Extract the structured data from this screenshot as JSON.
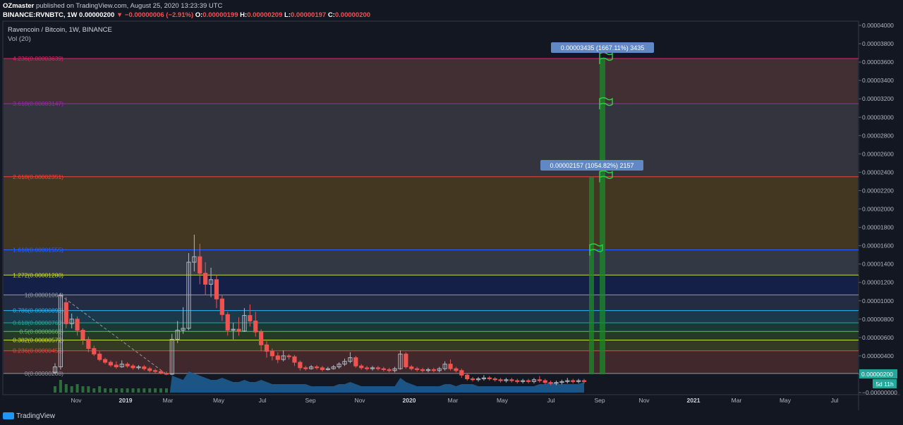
{
  "header": {
    "author": "OZmaster",
    "published_text": "published on TradingView.com, August 25, 2020 13:23:39 UTC",
    "symbol": "BINANCE:RVNBTC, 1W",
    "last_price": "0.00000200",
    "change": "▼ −0.00000006 (−2.91%)",
    "o_label": "O:",
    "o_value": "0.00000199",
    "h_label": "H:",
    "h_value": "0.00000209",
    "l_label": "L:",
    "l_value": "0.00000197",
    "c_label": "C:",
    "c_value": "0.00000200"
  },
  "chart_title": "Ravencoin / Bitcoin, 1W, BINANCE",
  "volume_title": "Vol (20)",
  "footer": {
    "brand": "TradingView"
  },
  "chart_data": {
    "type": "candlestick",
    "y_axis": {
      "min": 0.0,
      "max": 4e-05,
      "ticks": [
        "0.00004000",
        "0.00003800",
        "0.00003600",
        "0.00003400",
        "0.00003200",
        "0.00003000",
        "0.00002800",
        "0.00002600",
        "0.00002400",
        "0.00002200",
        "0.00002000",
        "0.00001800",
        "0.00001600",
        "0.00001400",
        "0.00001200",
        "0.00001000",
        "0.00000800",
        "0.00000600",
        "0.00000400",
        "0.00000200",
        "−0.00000000"
      ],
      "position": "right"
    },
    "x_axis": {
      "ticks": [
        "Nov",
        "2019",
        "Mar",
        "May",
        "Jul",
        "Sep",
        "Nov",
        "2020",
        "Mar",
        "May",
        "Jul",
        "Sep",
        "Nov",
        "2021",
        "Mar",
        "May",
        "Jul"
      ],
      "ticks_bold": [
        "2019",
        "2020",
        "2021"
      ]
    },
    "fib_levels": [
      {
        "label": "4.236(0.00003639)",
        "value": 3.639e-05,
        "color": "#e91e63"
      },
      {
        "label": "3.618(0.00003147)",
        "value": 3.147e-05,
        "color": "#9c27b0"
      },
      {
        "label": "2.618(0.00002351)",
        "value": 2.351e-05,
        "color": "#f44336"
      },
      {
        "label": "1.618(0.00001555)",
        "value": 1.555e-05,
        "color": "#2962ff"
      },
      {
        "label": "1.272(0.00001280)",
        "value": 1.28e-05,
        "color": "#cddc39"
      },
      {
        "label": "1(0.00001064)",
        "value": 1.064e-05,
        "color": "#9598a1"
      },
      {
        "label": "0.786(0.00000893)",
        "value": 8.93e-06,
        "color": "#29b6f6"
      },
      {
        "label": "0.618(0.00000760)",
        "value": 7.6e-06,
        "color": "#26a69a"
      },
      {
        "label": "0.5(0.00000666)",
        "value": 6.66e-06,
        "color": "#66bb6a"
      },
      {
        "label": "0.382(0.00000572)",
        "value": 5.72e-06,
        "color": "#cddc39"
      },
      {
        "label": "0.236(0.00000455)",
        "value": 4.55e-06,
        "color": "#f44336"
      },
      {
        "label": "0(0.00000208)",
        "value": 2.08e-06,
        "color": "#9598a1"
      }
    ],
    "target_labels": [
      {
        "text": "0.00003435 (1667.11%) 3435",
        "value": 3.435e-05
      },
      {
        "text": "0.00002157 (1054.82%) 2157",
        "value": 2.157e-05
      }
    ],
    "flags": [
      3.639e-05,
      3.147e-05,
      2.351e-05,
      1.555e-05
    ],
    "price_badge": {
      "value": "0.00000200",
      "countdown": "5d 11h"
    },
    "candles": [
      [
        2.2e-06,
        2.8e-06,
        3.2e-06,
        2e-06
      ],
      [
        2.8e-06,
        1.06e-05,
        1.08e-05,
        2.5e-06
      ],
      [
        9.8e-06,
        7.5e-06,
        1.04e-05,
        7e-06
      ],
      [
        7.5e-06,
        8e-06,
        8.6e-06,
        7e-06
      ],
      [
        8e-06,
        6.8e-06,
        8.3e-06,
        6.2e-06
      ],
      [
        6.8e-06,
        5.8e-06,
        7e-06,
        5.2e-06
      ],
      [
        5.8e-06,
        4.8e-06,
        6.1e-06,
        4.4e-06
      ],
      [
        4.8e-06,
        4.2e-06,
        5.1e-06,
        4e-06
      ],
      [
        4.2e-06,
        3.6e-06,
        4.5e-06,
        3.4e-06
      ],
      [
        3.6e-06,
        3.3e-06,
        3.8e-06,
        3.1e-06
      ],
      [
        3.3e-06,
        3e-06,
        3.5e-06,
        2.8e-06
      ],
      [
        3e-06,
        2.8e-06,
        3.4e-06,
        2.6e-06
      ],
      [
        2.8e-06,
        3.1e-06,
        3.5e-06,
        2.7e-06
      ],
      [
        3.1e-06,
        2.9e-06,
        3.3e-06,
        2.7e-06
      ],
      [
        2.9e-06,
        2.7e-06,
        3.1e-06,
        2.5e-06
      ],
      [
        2.7e-06,
        2.8e-06,
        3e-06,
        2.5e-06
      ],
      [
        2.8e-06,
        2.6e-06,
        3e-06,
        2.4e-06
      ],
      [
        2.6e-06,
        2.4e-06,
        2.8e-06,
        2.2e-06
      ],
      [
        2.4e-06,
        2.3e-06,
        2.6e-06,
        2.1e-06
      ],
      [
        2.3e-06,
        2.1e-06,
        2.5e-06,
        2e-06
      ],
      [
        2.1e-06,
        2e-06,
        2.3e-06,
        1.9e-06
      ],
      [
        2e-06,
        5.8e-06,
        6.4e-06,
        1.9e-06
      ],
      [
        5.8e-06,
        6.8e-06,
        7.8e-06,
        5.4e-06
      ],
      [
        6.8e-06,
        7e-06,
        9.3e-06,
        6.4e-06
      ],
      [
        7e-06,
        1.42e-05,
        1.52e-05,
        6.8e-06
      ],
      [
        1.42e-05,
        1.48e-05,
        1.72e-05,
        1.32e-05
      ],
      [
        1.48e-05,
        1.3e-05,
        1.62e-05,
        1.18e-05
      ],
      [
        1.3e-05,
        1.18e-05,
        1.42e-05,
        1.06e-05
      ],
      [
        1.18e-05,
        1.23e-05,
        1.36e-05,
        1.04e-05
      ],
      [
        1.23e-05,
        1.02e-05,
        1.28e-05,
        9.2e-06
      ],
      [
        1.02e-05,
        8.5e-06,
        1.06e-05,
        7.8e-06
      ],
      [
        8.5e-06,
        6.8e-06,
        8.8e-06,
        6.2e-06
      ],
      [
        6.8e-06,
        6.9e-06,
        7.6e-06,
        5.8e-06
      ],
      [
        6.9e-06,
        6.7e-06,
        8.2e-06,
        6.2e-06
      ],
      [
        6.7e-06,
        8.4e-06,
        9.2e-06,
        6.6e-06
      ],
      [
        8.4e-06,
        7.8e-06,
        9.6e-06,
        7.2e-06
      ],
      [
        7.8e-06,
        6.6e-06,
        8.8e-06,
        6.1e-06
      ],
      [
        6.6e-06,
        5.2e-06,
        6.9e-06,
        4.5e-06
      ],
      [
        5.2e-06,
        4.5e-06,
        5.6e-06,
        3.8e-06
      ],
      [
        4.5e-06,
        4e-06,
        4.8e-06,
        3.5e-06
      ],
      [
        4e-06,
        3.6e-06,
        4.4e-06,
        3.2e-06
      ],
      [
        3.6e-06,
        4e-06,
        4.6e-06,
        3.4e-06
      ],
      [
        4e-06,
        3.9e-06,
        4.2e-06,
        3.6e-06
      ],
      [
        3.9e-06,
        3.3e-06,
        4.1e-06,
        2.9e-06
      ],
      [
        3.3e-06,
        2.7e-06,
        3.5e-06,
        2.4e-06
      ],
      [
        2.7e-06,
        2.6e-06,
        2.9e-06,
        2.4e-06
      ],
      [
        2.6e-06,
        2.8e-06,
        3e-06,
        2.5e-06
      ],
      [
        2.8e-06,
        2.7e-06,
        3e-06,
        2.5e-06
      ],
      [
        2.7e-06,
        2.5e-06,
        2.9e-06,
        2.3e-06
      ],
      [
        2.5e-06,
        2.6e-06,
        2.8e-06,
        2.4e-06
      ],
      [
        2.6e-06,
        2.8e-06,
        3e-06,
        2.5e-06
      ],
      [
        2.8e-06,
        3.1e-06,
        3.3e-06,
        2.6e-06
      ],
      [
        3.1e-06,
        3.4e-06,
        3.7e-06,
        2.9e-06
      ],
      [
        3.4e-06,
        3.8e-06,
        4.4e-06,
        3.2e-06
      ],
      [
        3.8e-06,
        2.9e-06,
        4e-06,
        2.7e-06
      ],
      [
        2.9e-06,
        2.7e-06,
        3.1e-06,
        2.5e-06
      ],
      [
        2.7e-06,
        2.6e-06,
        2.9e-06,
        2.4e-06
      ],
      [
        2.6e-06,
        2.7e-06,
        2.9e-06,
        2.4e-06
      ],
      [
        2.7e-06,
        2.6e-06,
        2.9e-06,
        2.4e-06
      ],
      [
        2.6e-06,
        2.5e-06,
        2.8e-06,
        2.3e-06
      ],
      [
        2.5e-06,
        2.4e-06,
        2.7e-06,
        2.2e-06
      ],
      [
        2.4e-06,
        2.6e-06,
        2.8e-06,
        2.2e-06
      ],
      [
        2.6e-06,
        4.2e-06,
        4.6e-06,
        2.5e-06
      ],
      [
        4.2e-06,
        2.8e-06,
        4.4e-06,
        2.6e-06
      ],
      [
        2.8e-06,
        2.6e-06,
        3e-06,
        2.4e-06
      ],
      [
        2.6e-06,
        2.5e-06,
        2.8e-06,
        2.3e-06
      ],
      [
        2.5e-06,
        2.4e-06,
        2.7e-06,
        2.2e-06
      ],
      [
        2.4e-06,
        2.5e-06,
        2.7e-06,
        2.2e-06
      ],
      [
        2.5e-06,
        2.4e-06,
        2.7e-06,
        2.2e-06
      ],
      [
        2.4e-06,
        2.6e-06,
        2.8e-06,
        2.2e-06
      ],
      [
        2.6e-06,
        3.1e-06,
        3.4e-06,
        2.4e-06
      ],
      [
        3.1e-06,
        2.6e-06,
        3.6e-06,
        2.4e-06
      ],
      [
        2.6e-06,
        2.4e-06,
        2.8e-06,
        2.2e-06
      ],
      [
        2.4e-06,
        1.9e-06,
        2.6e-06,
        1.6e-06
      ],
      [
        1.9e-06,
        1.5e-06,
        2.1e-06,
        1.3e-06
      ],
      [
        1.5e-06,
        1.4e-06,
        1.7e-06,
        1.2e-06
      ],
      [
        1.4e-06,
        1.5e-06,
        1.7e-06,
        1.2e-06
      ],
      [
        1.5e-06,
        1.6e-06,
        1.9e-06,
        1.3e-06
      ],
      [
        1.6e-06,
        1.5e-06,
        1.8e-06,
        1.3e-06
      ],
      [
        1.5e-06,
        1.4e-06,
        1.7e-06,
        1.2e-06
      ],
      [
        1.4e-06,
        1.3e-06,
        1.6e-06,
        1.1e-06
      ],
      [
        1.3e-06,
        1.4e-06,
        1.6e-06,
        1.1e-06
      ],
      [
        1.4e-06,
        1.3e-06,
        1.6e-06,
        1.1e-06
      ],
      [
        1.3e-06,
        1.2e-06,
        1.5e-06,
        1e-06
      ],
      [
        1.2e-06,
        1.3e-06,
        1.5e-06,
        1e-06
      ],
      [
        1.3e-06,
        1.2e-06,
        1.5e-06,
        1e-06
      ],
      [
        1.2e-06,
        1.4e-06,
        1.6e-06,
        1e-06
      ],
      [
        1.4e-06,
        1.3e-06,
        1.8e-06,
        1.1e-06
      ],
      [
        1.3e-06,
        1.1e-06,
        1.5e-06,
        9e-07
      ],
      [
        1.1e-06,
        1e-06,
        1.3e-06,
        8e-07
      ],
      [
        1e-06,
        1.1e-06,
        1.3e-06,
        8e-07
      ],
      [
        1.1e-06,
        1.2e-06,
        1.4e-06,
        9e-07
      ],
      [
        1.2e-06,
        1.3e-06,
        1.6e-06,
        1e-06
      ],
      [
        1.3e-06,
        1.2e-06,
        1.5e-06,
        1e-06
      ],
      [
        1.2e-06,
        1.3e-06,
        1.5e-06,
        1e-06
      ],
      [
        1.3e-06,
        1.2e-06,
        1.5e-06,
        1e-06
      ]
    ],
    "volume": [
      3,
      6,
      4,
      3,
      4,
      3,
      3,
      2,
      3,
      2,
      2,
      2,
      2,
      2,
      2,
      2,
      2,
      2,
      2,
      2,
      2,
      8,
      7,
      6,
      10,
      9,
      8,
      7,
      6,
      6,
      7,
      6,
      5,
      5,
      6,
      5,
      5,
      6,
      5,
      4,
      4,
      4,
      4,
      4,
      4,
      4,
      3,
      3,
      3,
      3,
      3,
      4,
      4,
      5,
      4,
      3,
      3,
      3,
      3,
      3,
      3,
      3,
      7,
      5,
      4,
      3,
      3,
      3,
      3,
      3,
      4,
      4,
      3,
      4,
      4,
      4,
      3,
      3,
      3,
      3,
      3,
      3,
      3,
      3,
      3,
      3,
      3,
      4,
      4,
      5,
      4,
      4,
      4,
      4,
      4,
      5
    ]
  }
}
